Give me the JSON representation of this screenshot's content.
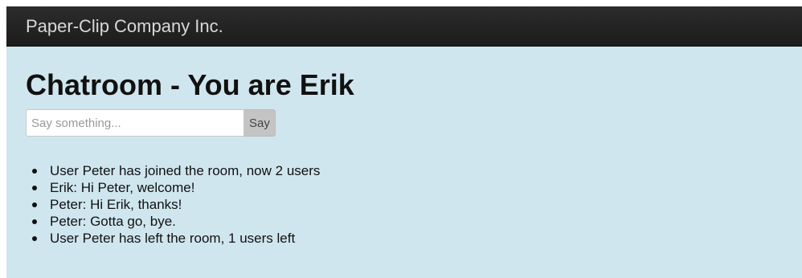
{
  "navbar": {
    "brand": "Paper-Clip Company Inc."
  },
  "main": {
    "title": "Chatroom - You are Erik",
    "input": {
      "placeholder": "Say something...",
      "value": ""
    },
    "say_button_label": "Say",
    "messages": [
      "User Peter has joined the room, now 2 users",
      "Erik: Hi Peter, welcome!",
      "Peter: Hi Erik, thanks!",
      "Peter: Gotta go, bye.",
      "User Peter has left the room, 1 users left"
    ]
  },
  "colors": {
    "navbar_bg": "#222222",
    "content_bg": "#d0e6ef",
    "button_bg": "#c4c4c4"
  }
}
